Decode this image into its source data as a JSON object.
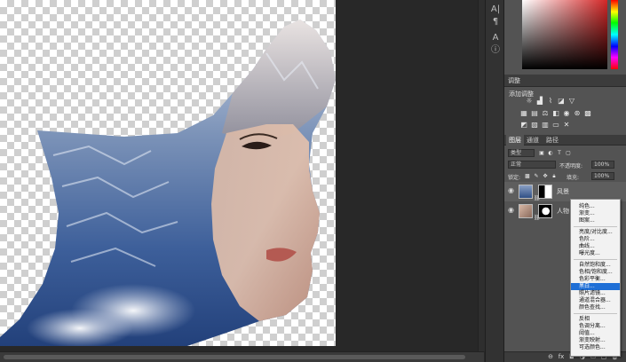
{
  "panels": {
    "adjustments": {
      "title": "调整",
      "subtitle": "添加调整"
    },
    "tabs": [
      {
        "label": "图层",
        "active": true
      },
      {
        "label": "通道",
        "active": false
      },
      {
        "label": "路径",
        "active": false
      }
    ],
    "kind_filter": "类型",
    "blend_mode": "正常",
    "opacity_label": "不透明度:",
    "opacity_value": "100%",
    "lock_label": "锁定:",
    "fill_label": "填充:",
    "fill_value": "100%",
    "layers": [
      {
        "name": "风景"
      },
      {
        "name": "人物"
      }
    ]
  },
  "context_menu": {
    "groups": [
      [
        {
          "label": "纯色..."
        },
        {
          "label": "渐变..."
        },
        {
          "label": "图案..."
        }
      ],
      [
        {
          "label": "亮度/对比度..."
        },
        {
          "label": "色阶..."
        },
        {
          "label": "曲线..."
        },
        {
          "label": "曝光度..."
        }
      ],
      [
        {
          "label": "自然饱和度..."
        },
        {
          "label": "色相/饱和度..."
        },
        {
          "label": "色彩平衡..."
        },
        {
          "label": "黑白...",
          "selected": true
        },
        {
          "label": "照片滤镜..."
        },
        {
          "label": "通道混合器..."
        },
        {
          "label": "颜色查找..."
        }
      ],
      [
        {
          "label": "反相"
        },
        {
          "label": "色调分离..."
        },
        {
          "label": "阈值..."
        },
        {
          "label": "渐变映射..."
        },
        {
          "label": "可选颜色..."
        }
      ]
    ]
  },
  "icons": {
    "strip": [
      "type-tool-icon",
      "paragraph-icon",
      "character-icon",
      "info-icon"
    ],
    "adjustments_row1": [
      "brightness-icon",
      "levels-icon",
      "curves-icon",
      "exposure-icon",
      "triangle-icon"
    ],
    "adjustments_row2": [
      "vibrance-icon",
      "hue-sat-icon",
      "balance-icon",
      "bw-icon",
      "photo-filter-icon",
      "channel-mixer-icon",
      "lookup-icon"
    ],
    "adjustments_row3": [
      "invert-icon",
      "posterize-icon",
      "threshold-icon",
      "gradient-map-icon",
      "selective-color-icon"
    ]
  }
}
